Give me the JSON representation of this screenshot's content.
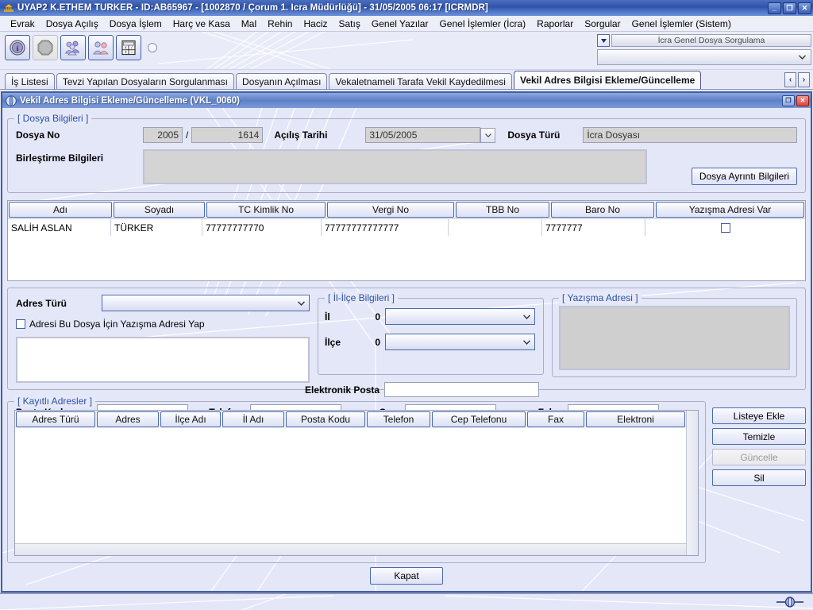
{
  "window": {
    "title": "UYAP2   K.ETHEM TÜRKER - ID:AB65967 - [1002870 / Çorum 1. İcra Müdürlüğü] - 31/05/2005 06:17 [ICRMDR]",
    "minimize": "_",
    "restore": "❐",
    "close": "✕"
  },
  "menubar": {
    "items": [
      {
        "label": "Evrak"
      },
      {
        "label": "Dosya Açılış"
      },
      {
        "label": "Dosya İşlem"
      },
      {
        "label": "Harç ve Kasa"
      },
      {
        "label": "Mal"
      },
      {
        "label": "Rehin"
      },
      {
        "label": "Haciz"
      },
      {
        "label": "Satış"
      },
      {
        "label": "Genel Yazılar"
      },
      {
        "label": "Genel İşlemler (İcra)"
      },
      {
        "label": "Raporlar"
      },
      {
        "label": "Sorgular"
      },
      {
        "label": "Genel İşlemler (Sistem)"
      }
    ]
  },
  "toolbar": {
    "buttons": [
      {
        "name": "info-icon",
        "label": ""
      },
      {
        "name": "stop-icon",
        "label": ""
      },
      {
        "name": "group-users-icon",
        "label": ""
      },
      {
        "name": "two-users-icon",
        "label": ""
      },
      {
        "name": "calculator-icon",
        "label": ""
      }
    ],
    "quick_search_value": "İcra Genel Dosya Sorgulama",
    "quick_select_value": ""
  },
  "tabs": [
    {
      "label": "İş Listesi",
      "active": false
    },
    {
      "label": "Tevzi Yapılan Dosyaların Sorgulanması",
      "active": false
    },
    {
      "label": "Dosyanın Açılması",
      "active": false
    },
    {
      "label": "Vekaletnameli Tarafa Vekil Kaydedilmesi",
      "active": false
    },
    {
      "label": "Vekil Adres Bilgisi Ekleme/Güncelleme",
      "active": true
    }
  ],
  "tabnav": {
    "prev": "‹",
    "next": "›"
  },
  "internal_window": {
    "title": "Vekil Adres Bilgisi Ekleme/Güncelleme (VKL_0060)",
    "restore": "❐",
    "close": "✕"
  },
  "dosya_bilgileri": {
    "legend": "[ Dosya Bilgileri ]",
    "dosya_no_label": "Dosya No",
    "dosya_no_year": "2005",
    "dosya_no_separator": "/",
    "dosya_no_seq": "1614",
    "acilis_tarihi_label": "Açılış Tarihi",
    "acilis_tarihi_value": "31/05/2005",
    "dosya_turu_label": "Dosya Türü",
    "dosya_turu_value": "İcra Dosyası",
    "birlestirme_label": "Birleştirme Bilgileri",
    "birlestirme_value": "",
    "detail_button": "Dosya Ayrıntı Bilgileri"
  },
  "party_table": {
    "columns": [
      "Adı",
      "Soyadı",
      "TC Kimlik No",
      "Vergi No",
      "TBB No",
      "Baro No",
      "Yazışma Adresi Var"
    ],
    "rows": [
      {
        "adi": "SALİH ASLAN",
        "soyadi": "TÜRKER",
        "tc_kimlik_no": "77777777770",
        "vergi_no": "77777777777777",
        "tbb_no": "",
        "baro_no": "7777777",
        "yazisma_adresi_var": false
      }
    ]
  },
  "address_form": {
    "adres_turu_label": "Adres Türü",
    "adres_turu_value": "",
    "yazisma_checkbox_label": "Adresi Bu Dosya İçin Yazışma Adresi Yap",
    "yazisma_checkbox_checked": false,
    "adres_textarea_value": "",
    "posta_kodu_label": "Posta Kodu",
    "posta_kodu_value": "",
    "telefon_label": "Telefon",
    "telefon_value": "",
    "cep_label": "Cep",
    "cep_value": "",
    "faks_label": "Faks",
    "faks_value": "",
    "elektronik_posta_label": "Elektronik Posta",
    "elektronik_posta_value": ""
  },
  "il_ilce": {
    "legend": "[ İl-İlçe Bilgileri ]",
    "il_label": "İl",
    "il_code": "0",
    "il_value": "",
    "ilce_label": "İlçe",
    "ilce_code": "0",
    "ilce_value": ""
  },
  "yazisma_adresi": {
    "legend": "[ Yazışma Adresi ]",
    "value": ""
  },
  "kayitli_adresler": {
    "legend": "[ Kayıtlı Adresler ]",
    "columns": [
      "Adres Türü",
      "Adres",
      "İlçe Adı",
      "İl Adı",
      "Posta Kodu",
      "Telefon",
      "Cep Telefonu",
      "Fax",
      "Elektroni"
    ],
    "rows": []
  },
  "side_buttons": [
    {
      "label": "Listeye Ekle",
      "enabled": true
    },
    {
      "label": "Temizle",
      "enabled": true
    },
    {
      "label": "Güncelle",
      "enabled": false
    },
    {
      "label": "Sil",
      "enabled": true
    }
  ],
  "footer": {
    "close_button": "Kapat"
  },
  "colors": {
    "title_blue": "#2f51a8",
    "accent_blue": "#4a6bb0",
    "legend_blue": "#2a4fa8",
    "panel_bg": "#e4e7f8",
    "readonly_gray": "#d4d4d4",
    "close_red": "#d9453c"
  }
}
